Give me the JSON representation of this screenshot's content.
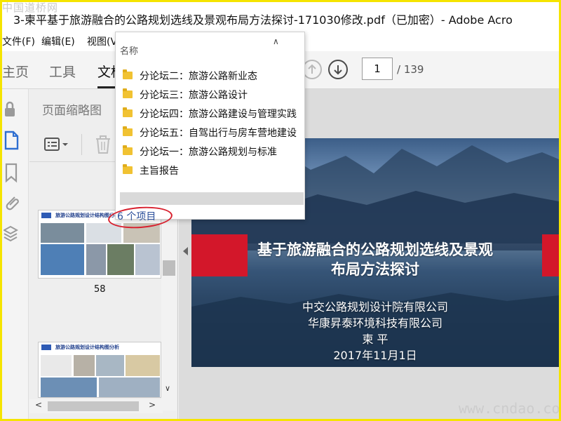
{
  "watermark_top": "中国道桥网",
  "watermark_bottom": "www.cndao.com",
  "window": {
    "title": "3-柬平基于旅游融合的公路规划选线及景观布局方法探讨-171030修改.pdf（已加密）- Adobe Acro"
  },
  "menu": {
    "file": "文件(F)",
    "edit": "编辑(E)",
    "view": "视图(V"
  },
  "tabs": {
    "home": "主页",
    "tools": "工具",
    "document": "文档"
  },
  "pagenav": {
    "current": "1",
    "total": "/ 139"
  },
  "thumbnails": {
    "title": "页面缩略图",
    "page_label": "58",
    "thumb_header_1": "旅游公路规划设计结构图分析",
    "thumb_header_2": "旅游公路规划设计结构图分析"
  },
  "popup": {
    "header": "名称",
    "items": [
      "分论坛二：旅游公路新业态",
      "分论坛三：旅游公路设计",
      "分论坛四：旅游公路建设与管理实践",
      "分论坛五：自驾出行与房车营地建设",
      "分论坛一：旅游公路规划与标准",
      "主旨报告"
    ],
    "count": "6 个项目"
  },
  "slide": {
    "title_line1": "基于旅游融合的公路规划选线及景观",
    "title_line2": "布局方法探讨",
    "org1": "中交公路规划设计院有限公司",
    "org2": "华康昇泰环境科技有限公司",
    "author": "柬 平",
    "date": "2017年11月1日"
  },
  "colors": {
    "accent_red": "#d3172a",
    "frame_yellow": "#f5e400",
    "folder_yellow": "#f1c232",
    "link_blue": "#2a4e9a"
  }
}
